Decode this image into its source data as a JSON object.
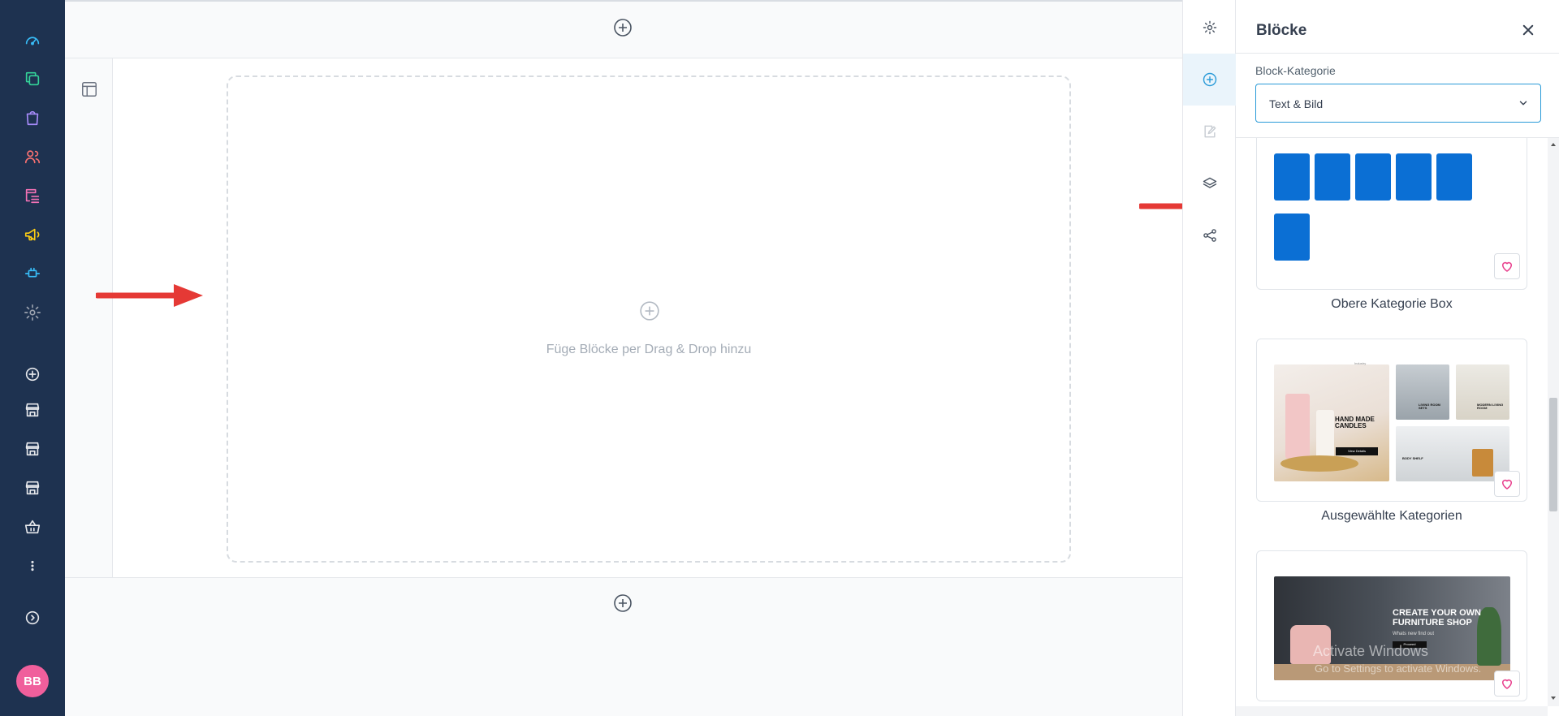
{
  "colors": {
    "sidebar_bg": "#1e3250",
    "accent": "#2a9bd8",
    "tile_blue": "#0b6fd4",
    "arrow_red": "#e53935",
    "avatar_pink": "#f05f9c",
    "heart_pink": "#e83e8c"
  },
  "sidebar": {
    "items": [
      {
        "icon": "dashboard-gauge-icon",
        "color": "#38bdf8"
      },
      {
        "icon": "copy-stack-icon",
        "color": "#34d399"
      },
      {
        "icon": "shopping-bag-icon",
        "color": "#a78bfa"
      },
      {
        "icon": "users-icon",
        "color": "#f87171"
      },
      {
        "icon": "content-list-icon",
        "color": "#f472b6"
      },
      {
        "icon": "megaphone-icon",
        "color": "#facc15"
      },
      {
        "icon": "plug-extension-icon",
        "color": "#38bdf8"
      },
      {
        "icon": "settings-gear-icon",
        "color": "#9ca3af"
      },
      {
        "icon": "plus-circle-icon",
        "color": "#e5e7eb"
      },
      {
        "icon": "storefront-icon",
        "color": "#e5e7eb"
      },
      {
        "icon": "storefront-icon",
        "color": "#e5e7eb"
      },
      {
        "icon": "storefront-icon",
        "color": "#e5e7eb"
      },
      {
        "icon": "basket-icon",
        "color": "#e5e7eb"
      },
      {
        "icon": "more-vertical-icon",
        "color": "#e5e7eb"
      },
      {
        "icon": "expand-chevron-icon",
        "color": "#e5e7eb"
      }
    ],
    "avatar_initials": "BB"
  },
  "canvas": {
    "dropzone_text": "Füge Blöcke per Drag & Drop hinzu"
  },
  "toolbar": {
    "items": [
      {
        "icon": "settings-gear-icon",
        "active": false
      },
      {
        "icon": "plus-circle-icon",
        "active": true
      },
      {
        "icon": "edit-note-icon",
        "active": false
      },
      {
        "icon": "layers-icon",
        "active": false
      },
      {
        "icon": "share-icon",
        "active": false
      }
    ]
  },
  "panel": {
    "title": "Blöcke",
    "category_label": "Block-Kategorie",
    "category_value": "Text & Bild",
    "blocks": [
      {
        "name": "Obere Kategorie Box"
      },
      {
        "name": "Ausgewählte Kategorien"
      },
      {
        "name": ""
      }
    ],
    "preview2": {
      "heading": "HAND MADE CANDLES",
      "tile_a": "LIVING ROOM SETS",
      "tile_b": "MODERN LIVING ROOM",
      "tile_c": "BODY SHELF",
      "button": "View Details",
      "top": "Industry"
    },
    "preview3": {
      "heading": "CREATE YOUR OWN FURNITURE SHOP",
      "sub": "Whats new find out",
      "button": "Proceed",
      "watermark_1": "Activate Windows",
      "watermark_2": "Go to Settings to activate Windows."
    }
  }
}
